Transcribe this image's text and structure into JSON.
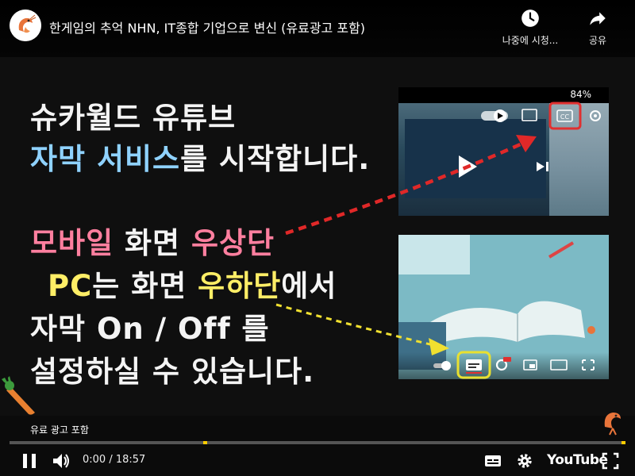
{
  "header": {
    "title": "한게임의 추억 NHN, IT종합 기업으로 변신 (유료광고 포함)",
    "watch_later_label": "나중에 시청...",
    "share_label": "공유"
  },
  "slide": {
    "line1": "슈카월드 유튜브",
    "line2_a": "자막 서비스",
    "line2_b": "를 시작합니다.",
    "line3_a": "모바일",
    "line3_b": " 화면 ",
    "line3_c": "우상단",
    "line4_a": "PC",
    "line4_b": "는 화면 ",
    "line4_c": "우하단",
    "line4_d": "에서",
    "line5": "자막 On / Off 를",
    "line6": "설정하실 수 있습니다.",
    "phone_status": "84%"
  },
  "player": {
    "ad_label": "유료 광고 포함",
    "time": "0:00 / 18:57",
    "brand": "YouTube",
    "progress": 0
  },
  "icons": {
    "watch_later": "clock-icon",
    "share": "share-arrow-icon",
    "play": "pause-icon",
    "volume": "volume-icon",
    "captions": "subtitles-icon",
    "settings": "gear-icon",
    "fullscreen": "fullscreen-icon"
  },
  "colors": {
    "highlight_red": "#e03030",
    "highlight_yellow": "#e8e030",
    "progress": "#ff0000",
    "ad_marker": "#ffcc00"
  }
}
